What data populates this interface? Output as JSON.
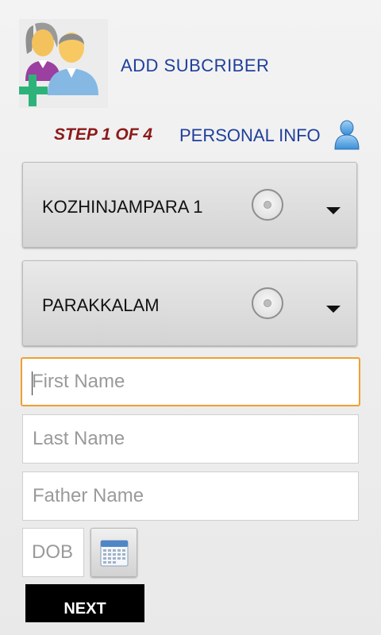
{
  "header": {
    "title": "ADD SUBCRIBER",
    "icon": "add-subscriber-icon"
  },
  "step": {
    "label": "STEP 1 OF 4",
    "title": "PERSONAL INFO",
    "icon": "user-icon"
  },
  "spinners": [
    {
      "value": "KOZHINJAMPARA 1"
    },
    {
      "value": "PARAKKALAM"
    }
  ],
  "fields": {
    "first_name": {
      "placeholder": "First Name",
      "value": ""
    },
    "last_name": {
      "placeholder": "Last Name",
      "value": ""
    },
    "father_name": {
      "placeholder": "Father Name",
      "value": ""
    },
    "dob": {
      "placeholder": "DOB",
      "value": ""
    }
  },
  "calendar_button": {
    "icon": "calendar-icon"
  },
  "next_button": {
    "label": "NEXT"
  },
  "colors": {
    "accent_blue": "#1f3f9a",
    "step_red": "#8b1a1a",
    "focus_orange": "#f0a030",
    "plus_green": "#2db37a"
  }
}
